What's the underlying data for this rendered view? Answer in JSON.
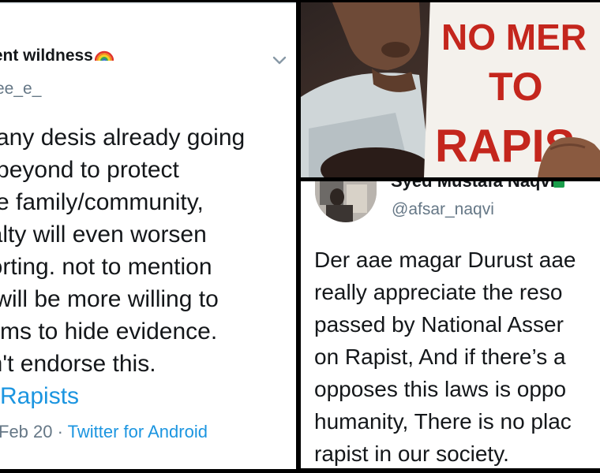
{
  "left_tweet": {
    "display_name": "ient wildness",
    "rainbow_icon": "rainbow-emoji",
    "handle": "ee_e_",
    "menu_icon": "chevron-down-icon",
    "body_lines": [
      "many desis already going",
      "d beyond to protect",
      "the family/community,",
      "nalty will even worsen",
      "porting. not to mention",
      "s will be more willing to",
      "ctims to hide evidence.",
      "on't endorse this."
    ],
    "hashtag": "ildRapists",
    "date": "Feb 20 ·",
    "source": "Twitter for Android"
  },
  "photo": {
    "sign_lines": [
      "NO MER",
      "TO",
      "RAPIS"
    ],
    "sign_color": "#c4261d"
  },
  "right_tweet": {
    "display_name": "Syed Mustafa Naqvi",
    "handle": "@afsar_naqvi",
    "body_lines": [
      "Der aae magar Durust aae",
      "really appreciate the reso",
      "passed by National Asser",
      "on Rapist, And if there’s a",
      "opposes this laws is oppo",
      "humanity, There is no plac",
      "rapist in our society."
    ]
  },
  "colors": {
    "text": "#14171a",
    "secondary": "#657786",
    "link": "#1b95e0"
  }
}
